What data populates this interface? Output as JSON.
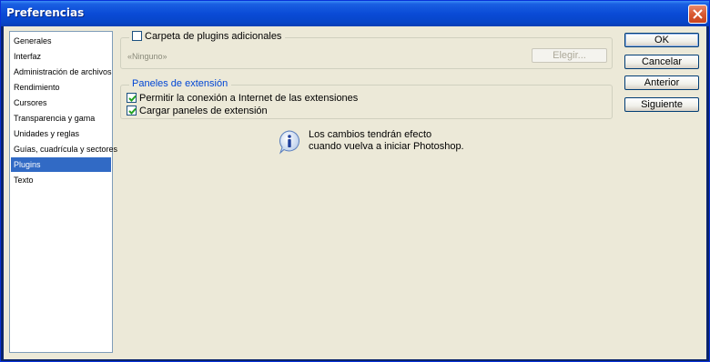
{
  "window": {
    "title": "Preferencias",
    "close_icon": "close-icon"
  },
  "nav": {
    "items": [
      {
        "label": "Generales",
        "selected": false
      },
      {
        "label": "Interfaz",
        "selected": false
      },
      {
        "label": "Administración de archivos",
        "selected": false
      },
      {
        "label": "Rendimiento",
        "selected": false
      },
      {
        "label": "Cursores",
        "selected": false
      },
      {
        "label": "Transparencia y gama",
        "selected": false
      },
      {
        "label": "Unidades y reglas",
        "selected": false
      },
      {
        "label": "Guías, cuadrícula y sectores",
        "selected": false
      },
      {
        "label": "Plugins",
        "selected": true
      },
      {
        "label": "Texto",
        "selected": false
      }
    ]
  },
  "plugins_folder": {
    "checkbox_label": "Carpeta de plugins adicionales",
    "checked": false,
    "path_text": "«Ninguno»",
    "choose_label": "Elegir..."
  },
  "extension_panels": {
    "group_title": "Paneles de extensión",
    "allow_internet_label": "Permitir la conexión a Internet de las extensiones",
    "allow_internet_checked": true,
    "load_panels_label": "Cargar paneles de extensión",
    "load_panels_checked": true
  },
  "notice": {
    "icon": "info-icon",
    "line1": "Los cambios tendrán efecto",
    "line2": "cuando vuelva a iniciar Photoshop."
  },
  "buttons": {
    "ok": "OK",
    "cancel": "Cancelar",
    "previous": "Anterior",
    "next": "Siguiente"
  },
  "colors": {
    "title_bar": "#0a4bd6",
    "selection": "#316ac5",
    "dialog_bg": "#ece9d8",
    "group_title": "#0046d5",
    "close_button": "#d95a32"
  }
}
